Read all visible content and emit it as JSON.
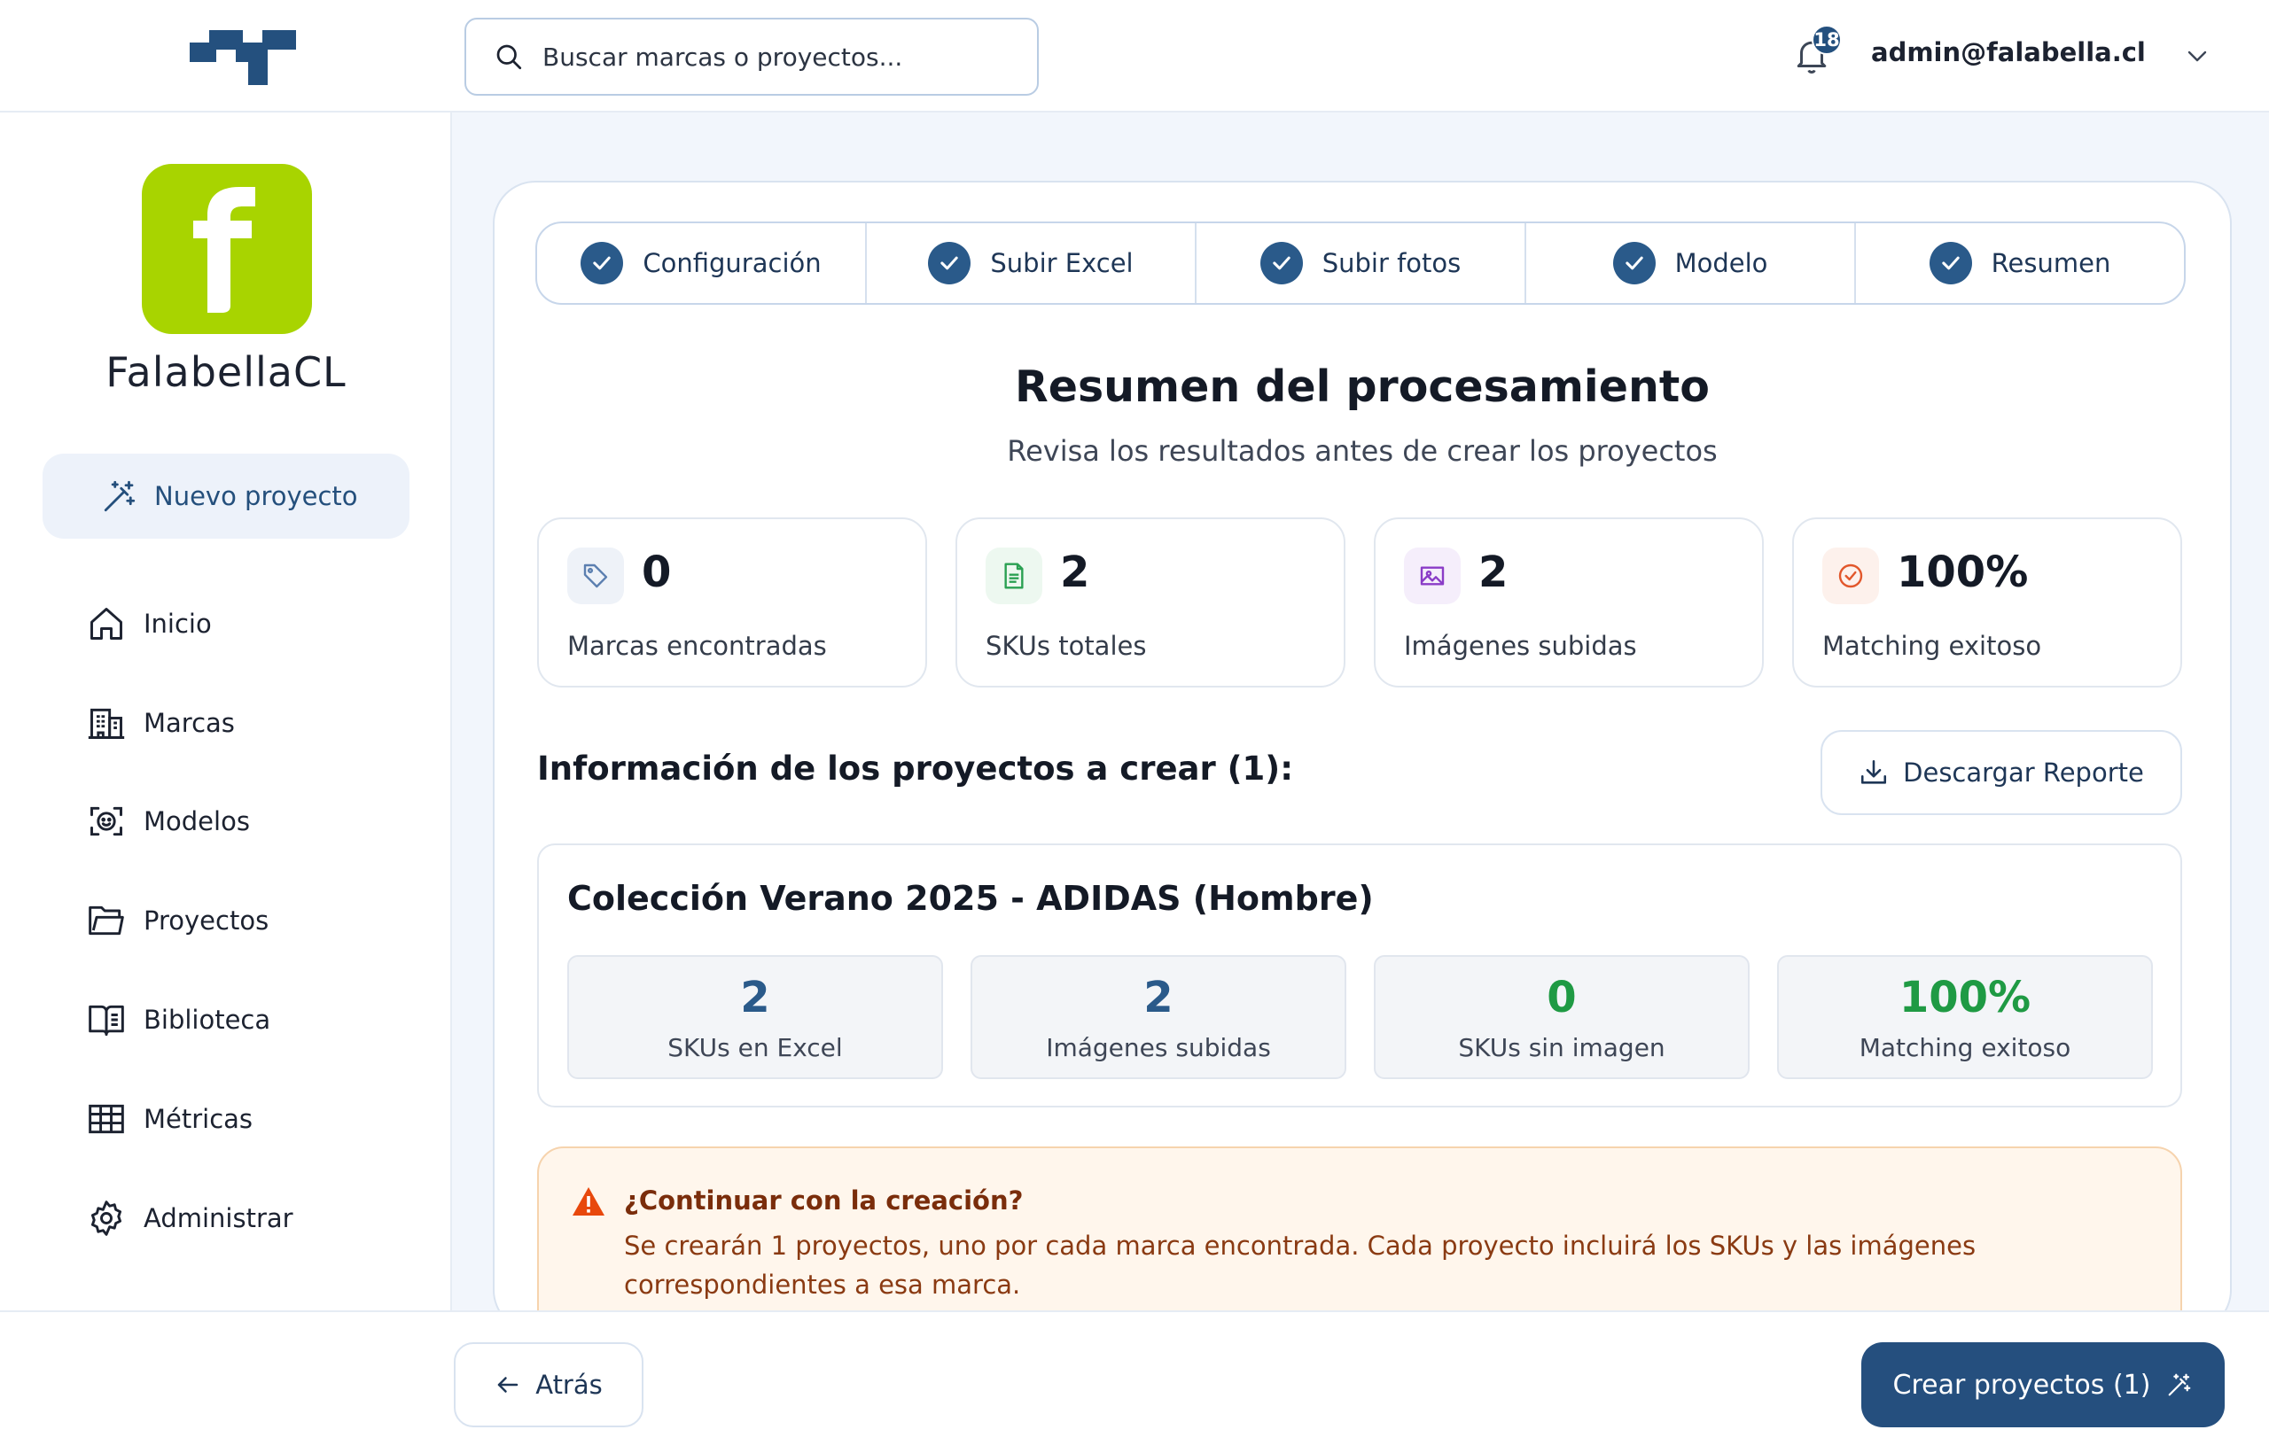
{
  "header": {
    "search_placeholder": "Buscar marcas o proyectos...",
    "notifications_count": "18",
    "user_email": "admin@falabella.cl"
  },
  "sidebar": {
    "brand_letter": "f",
    "brand_name": "FalabellaCL",
    "new_project_label": "Nuevo proyecto",
    "items": [
      {
        "label": "Inicio",
        "icon": "home-icon"
      },
      {
        "label": "Marcas",
        "icon": "building-icon"
      },
      {
        "label": "Modelos",
        "icon": "face-scan-icon"
      },
      {
        "label": "Proyectos",
        "icon": "folder-icon"
      },
      {
        "label": "Biblioteca",
        "icon": "book-icon"
      },
      {
        "label": "Métricas",
        "icon": "table-icon"
      },
      {
        "label": "Administrar",
        "icon": "gear-icon"
      }
    ]
  },
  "stepper": {
    "steps": [
      {
        "label": "Configuración",
        "done": true
      },
      {
        "label": "Subir Excel",
        "done": true
      },
      {
        "label": "Subir fotos",
        "done": true
      },
      {
        "label": "Modelo",
        "done": true
      },
      {
        "label": "Resumen",
        "done": true
      }
    ]
  },
  "summary": {
    "title": "Resumen del procesamiento",
    "subtitle": "Revisa los resultados antes de crear los proyectos",
    "stats": [
      {
        "value": "0",
        "label": "Marcas encontradas",
        "icon": "tag-icon",
        "color": "#5b7fb0"
      },
      {
        "value": "2",
        "label": "SKUs totales",
        "icon": "file-icon",
        "color": "#2aa052"
      },
      {
        "value": "2",
        "label": "Imágenes subidas",
        "icon": "image-icon",
        "color": "#8a3cc7"
      },
      {
        "value": "100%",
        "label": "Matching exitoso",
        "icon": "check-circle-icon",
        "color": "#e2572b"
      }
    ]
  },
  "projects": {
    "heading": "Información de los proyectos a crear (1):",
    "download_label": "Descargar Reporte",
    "list": [
      {
        "name": "Colección Verano 2025 - ADIDAS (Hombre)",
        "stats": [
          {
            "value": "2",
            "label": "SKUs en Excel",
            "color": "#2a5a8a"
          },
          {
            "value": "2",
            "label": "Imágenes subidas",
            "color": "#2a5a8a"
          },
          {
            "value": "0",
            "label": "SKUs sin imagen",
            "color": "#1f9a44"
          },
          {
            "value": "100%",
            "label": "Matching exitoso",
            "color": "#1f9a44"
          }
        ]
      }
    ]
  },
  "warning": {
    "title": "¿Continuar con la creación?",
    "text": "Se crearán 1 proyectos, uno por cada marca encontrada. Cada proyecto incluirá los SKUs y las imágenes correspondientes a esa marca."
  },
  "footer": {
    "back_label": "Atrás",
    "create_label": "Crear proyectos (1)"
  },
  "colors": {
    "primary": "#254f7e",
    "brand_green": "#a8d400"
  }
}
